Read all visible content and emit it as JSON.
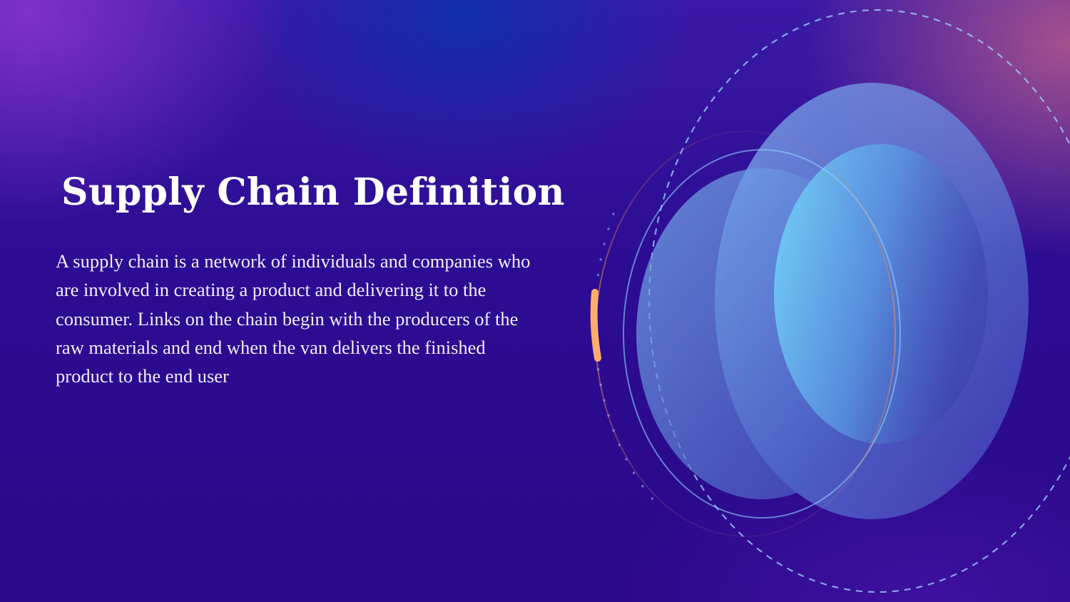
{
  "slide": {
    "title": "Supply Chain Definition",
    "body": "A supply chain is a network of individuals and companies who are involved in creating a product and delivering it to the consumer. Links on the chain begin with the producers of the raw materials and end when the van delivers the finished product to the end user"
  },
  "colors": {
    "background_deep": "#2a0988",
    "background_violet": "#8c34d2",
    "background_blue": "#0c30aa",
    "background_pink": "#aa548c",
    "ellipse_light": "#7fd6ff",
    "ellipse_mid": "#6aa0e8",
    "orange_accent": "#ffad6b",
    "dashed_ring": "#9fd8ff"
  },
  "decoration": {
    "icon": "concentric-ellipses-illustration"
  }
}
